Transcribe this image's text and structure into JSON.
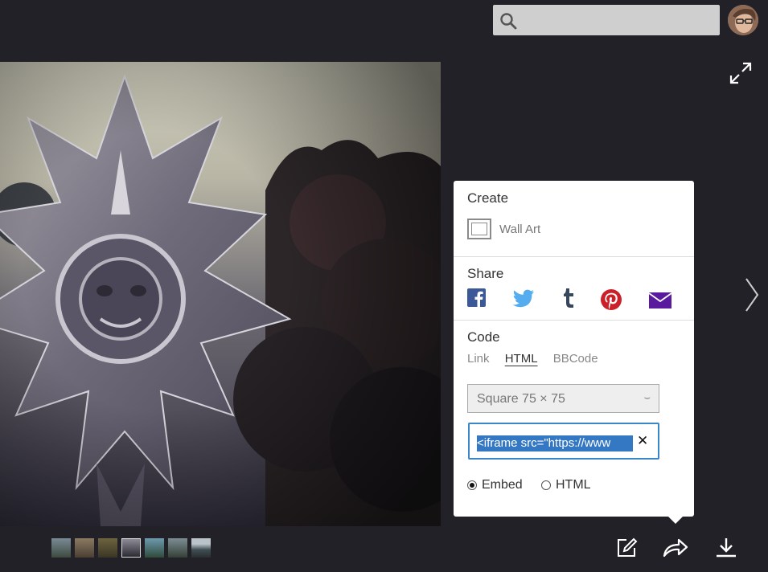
{
  "search": {
    "placeholder": ""
  },
  "panel": {
    "create": {
      "title": "Create",
      "wall_art_label": "Wall Art"
    },
    "share": {
      "title": "Share",
      "icons": [
        "facebook-icon",
        "twitter-icon",
        "tumblr-icon",
        "pinterest-icon",
        "email-icon"
      ]
    },
    "code": {
      "title": "Code",
      "tabs": [
        "Link",
        "HTML",
        "BBCode"
      ],
      "active_tab": "HTML",
      "size_option": "Square 75 × 75",
      "embed_code": "<iframe src=\"https://www",
      "radio_embed": "Embed",
      "radio_html": "HTML",
      "selected_radio": "Embed"
    }
  },
  "thumbnails": {
    "count": 7,
    "selected_index": 3
  },
  "colors": {
    "background": "#222127",
    "accent": "#3478c4",
    "facebook": "#3b5998",
    "twitter": "#55acee",
    "tumblr": "#36465d",
    "pinterest": "#cb2027",
    "email": "#5a1a9e"
  }
}
